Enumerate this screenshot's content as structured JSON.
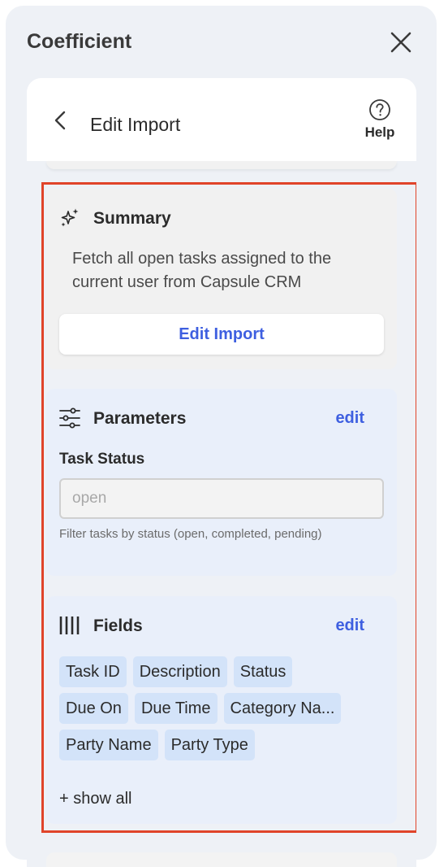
{
  "app": {
    "title": "Coefficient"
  },
  "header": {
    "title": "Edit Import",
    "help_label": "Help"
  },
  "summary": {
    "title": "Summary",
    "text": "Fetch all open tasks assigned to the current user from Capsule CRM",
    "button_label": "Edit Import"
  },
  "parameters": {
    "title": "Parameters",
    "edit_label": "edit",
    "field_label": "Task Status",
    "field_placeholder": "open",
    "field_hint": "Filter tasks by status (open, completed, pending)"
  },
  "fields": {
    "title": "Fields",
    "edit_label": "edit",
    "chips": [
      [
        "Task ID",
        "Description",
        "Status"
      ],
      [
        "Due On",
        "Due Time",
        "Category Na..."
      ],
      [
        "Party Name",
        "Party Type"
      ]
    ],
    "show_all_label": "+ show all"
  },
  "colors": {
    "accent": "#3e5fe0",
    "highlight": "#e0442a",
    "card_blue": "#e9effa",
    "chip": "#d3e3f9"
  },
  "icons": {
    "close": "close-icon",
    "back": "chevron-left-icon",
    "help": "question-circle-icon",
    "summary": "sparkles-icon",
    "parameters": "sliders-icon",
    "fields": "columns-icon"
  }
}
